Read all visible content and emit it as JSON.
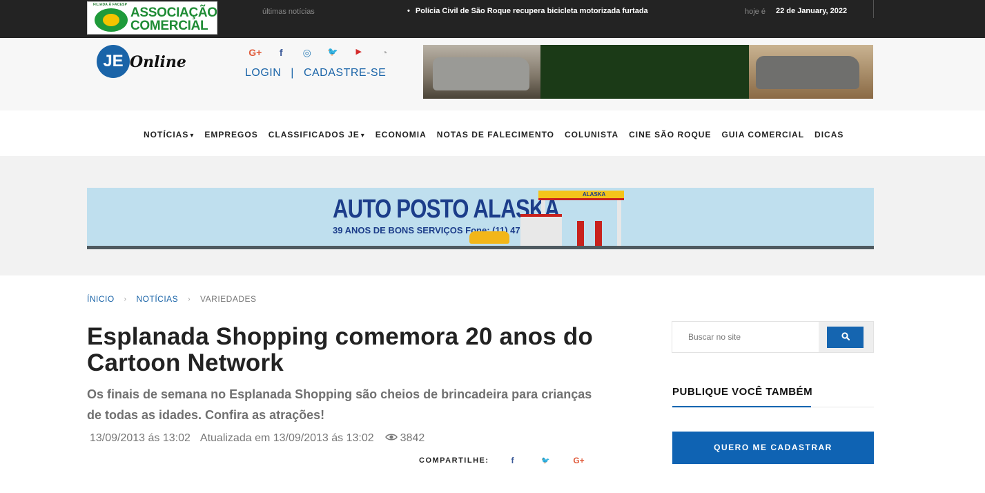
{
  "topbar": {
    "logo": {
      "small": "FILIADA À FACESP",
      "line1": "ASSOCIAÇÃO",
      "line2": "COMERCIAL"
    },
    "ultimas_label": "últimas notícias",
    "ticker_headline": "Polícia Civil de São Roque recupera bicicleta motorizada furtada",
    "hoje_label": "hoje é",
    "date": "22 de January, 2022"
  },
  "header": {
    "site_logo": {
      "mark": "JE",
      "word": "Online"
    },
    "social_icons": [
      {
        "name": "google-plus-icon",
        "glyph": "G+",
        "color": "#e05a3a"
      },
      {
        "name": "facebook-icon",
        "glyph": "f",
        "color": "#3b5998"
      },
      {
        "name": "instagram-icon",
        "glyph": "◎",
        "color": "#2f7fb8"
      },
      {
        "name": "twitter-icon",
        "glyph": "🐦",
        "color": "#1da1f2"
      },
      {
        "name": "youtube-icon",
        "glyph": "▶",
        "color": "#d42b2b"
      },
      {
        "name": "rss-icon",
        "glyph": "◔",
        "color": "#aaaaaa"
      }
    ],
    "login_label": "LOGIN",
    "pipe": "|",
    "signup_label": "CADASTRE-SE"
  },
  "nav": {
    "items": [
      {
        "label": "NOTÍCIAS",
        "dropdown": true
      },
      {
        "label": "EMPREGOS",
        "dropdown": false
      },
      {
        "label": "CLASSIFICADOS JE",
        "dropdown": true
      },
      {
        "label": "ECONOMIA",
        "dropdown": false
      },
      {
        "label": "NOTAS DE FALECIMENTO",
        "dropdown": false
      },
      {
        "label": "COLUNISTA",
        "dropdown": false
      },
      {
        "label": "CINE SÃO ROQUE",
        "dropdown": false
      },
      {
        "label": "GUIA COMERCIAL",
        "dropdown": false
      },
      {
        "label": "DICAS",
        "dropdown": false
      }
    ]
  },
  "ad": {
    "title": "AUTO POSTO ALASKA",
    "subtitle": "39 ANOS DE BONS SERVIÇOS Fone: (11) 471 - 3475",
    "brand": "ALASKA"
  },
  "breadcrumb": {
    "home": "ÍNICIO",
    "section": "NOTÍCIAS",
    "current": "VARIEDADES",
    "chev": "›"
  },
  "article": {
    "headline": "Esplanada Shopping comemora 20 anos do Cartoon Network",
    "lead": "Os finais de semana no Esplanada Shopping são cheios de brincadeira para crianças de todas as idades. Confira as atrações!",
    "published": "13/09/2013 ás 13:02",
    "updated": "Atualizada em 13/09/2013 ás 13:02",
    "views": "3842",
    "share_label": "COMPARTILHE:",
    "share_icons": [
      {
        "name": "share-facebook-icon",
        "glyph": "f",
        "color": "#3b5998"
      },
      {
        "name": "share-twitter-icon",
        "glyph": "🐦",
        "color": "#1da1f2"
      },
      {
        "name": "share-google-plus-icon",
        "glyph": "G+",
        "color": "#e05a3a"
      }
    ]
  },
  "sidebar": {
    "search_placeholder": "Buscar no site",
    "search_icon": "search-icon",
    "publish_title": "PUBLIQUE VOCÊ TAMBÉM",
    "signup_button": "QUERO ME CADASTRAR"
  },
  "colors": {
    "accent": "#1565b0",
    "topbar_bg": "#232323",
    "lead_text": "#707070"
  }
}
